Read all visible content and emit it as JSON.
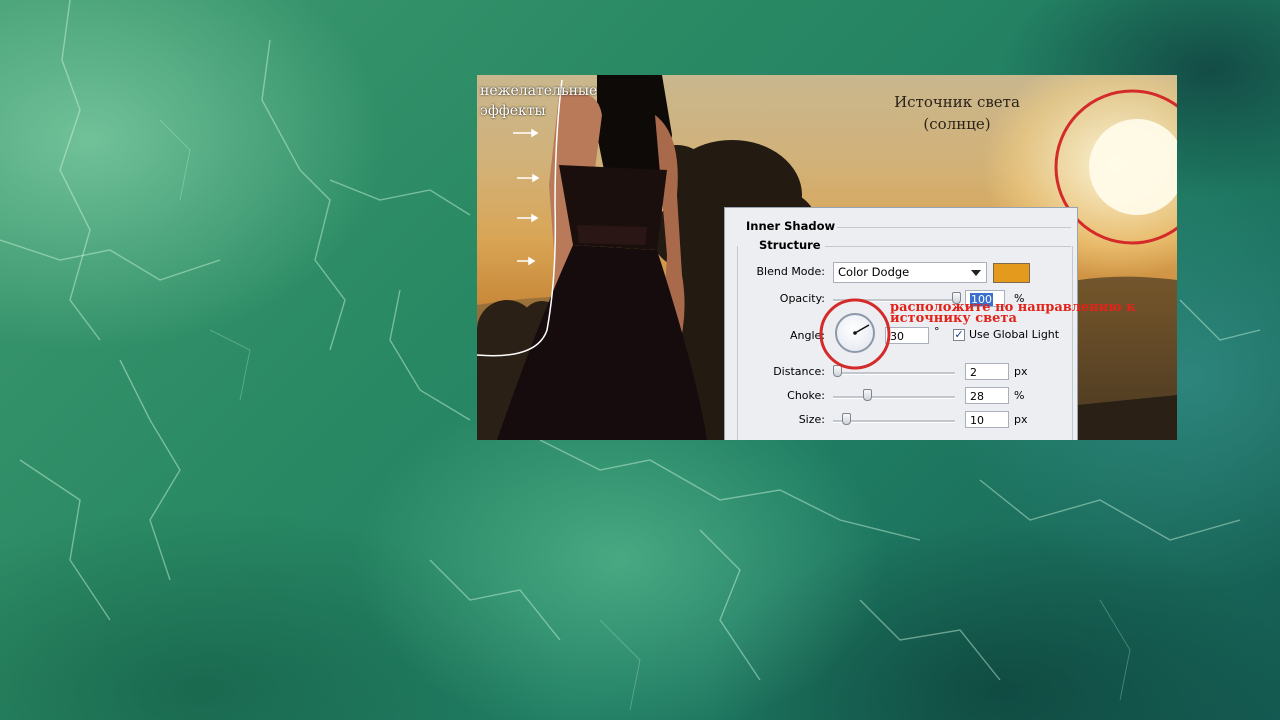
{
  "left_hint": {
    "line1": "нежелательные",
    "line2": "эффекты"
  },
  "sun_label": {
    "line1": "Источник света",
    "line2": "(солнце)"
  },
  "panel": {
    "group_title": "Inner Shadow",
    "section_title": "Structure",
    "blend_mode": {
      "label": "Blend Mode:",
      "value": "Color Dodge",
      "swatch_color": "#e39a1d"
    },
    "opacity": {
      "label": "Opacity:",
      "value": "100",
      "unit": "%",
      "level": 100
    },
    "angle": {
      "label": "Angle:",
      "value": "30",
      "unit": "°",
      "use_global_light_label": "Use Global Light",
      "use_global_light_checked": true
    },
    "distance": {
      "label": "Distance:",
      "value": "2",
      "unit": "px"
    },
    "choke": {
      "label": "Choke:",
      "value": "28",
      "unit": "%"
    },
    "size": {
      "label": "Size:",
      "value": "10",
      "unit": "px"
    }
  },
  "annotation": {
    "line1": "расположите по направлению к",
    "line2": "источнику света"
  },
  "colors": {
    "annotation_red": "#e2231a",
    "highlight_circle": "#d42a2a"
  }
}
